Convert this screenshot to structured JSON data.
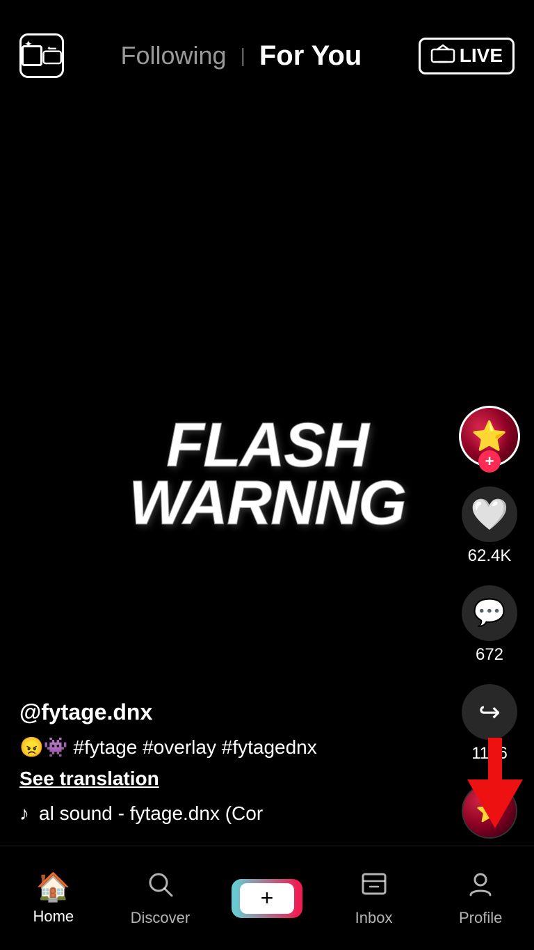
{
  "header": {
    "following_label": "Following",
    "for_you_label": "For You",
    "live_label": "LIVE"
  },
  "video": {
    "overlay_text": "FLASH WARNNG"
  },
  "sidebar": {
    "follow_plus": "+",
    "like_count": "62.4K",
    "comment_count": "672",
    "share_count": "1136"
  },
  "post": {
    "username": "@fytage.dnx",
    "caption": "😠👾 #fytage #overlay #fytagednx",
    "see_translation": "See translation",
    "sound": "al sound - fytage.dnx (Cor"
  },
  "bottom_nav": {
    "home_label": "Home",
    "discover_label": "Discover",
    "inbox_label": "Inbox",
    "profile_label": "Profile"
  }
}
